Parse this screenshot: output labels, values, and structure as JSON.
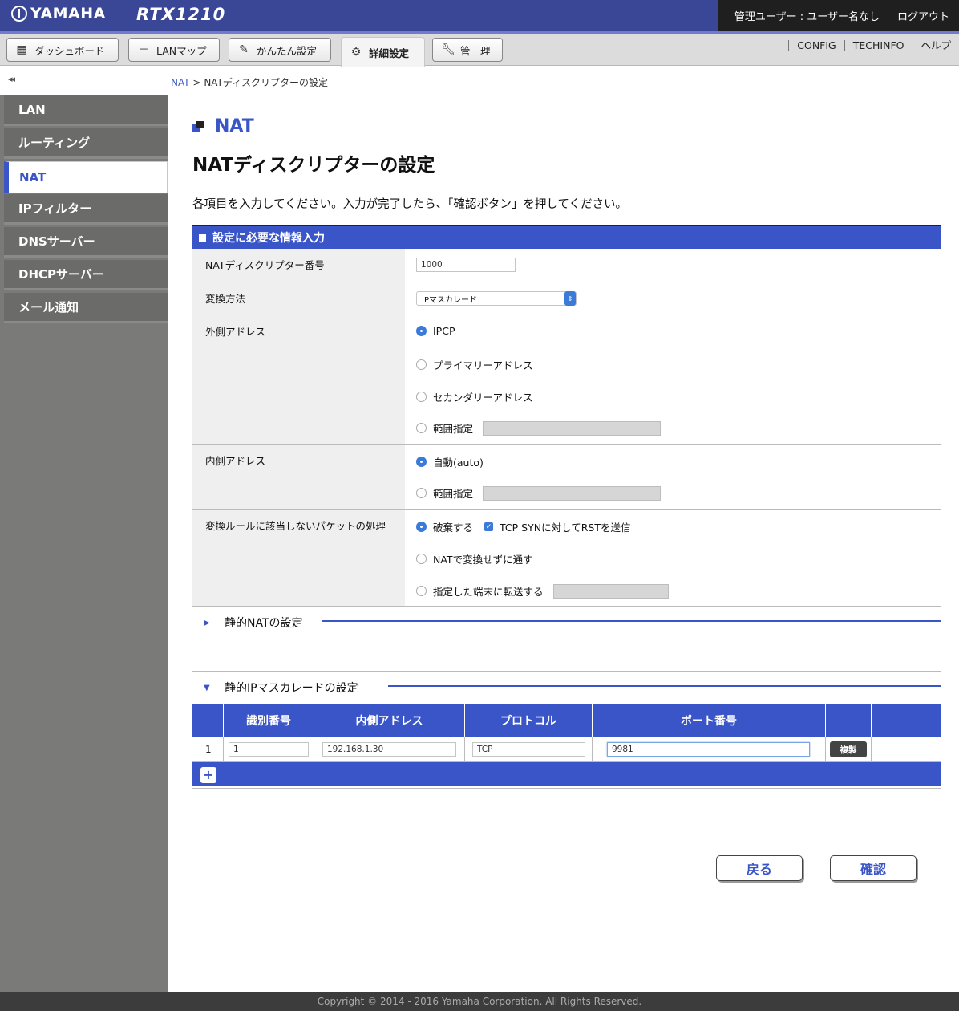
{
  "header": {
    "brand": "YAMAHA",
    "model": "RTX1210",
    "user_label": "管理ユーザー : ユーザー名なし",
    "logout": "ログアウト"
  },
  "tabs": [
    {
      "label": "ダッシュボード",
      "icon": "dashboard-icon"
    },
    {
      "label": "LANマップ",
      "icon": "lan-map-icon"
    },
    {
      "label": "かんたん設定",
      "icon": "wand-icon"
    },
    {
      "label": "詳細設定",
      "icon": "gear-icon",
      "active": true
    },
    {
      "label": "管　理",
      "icon": "wrench-icon"
    }
  ],
  "top_links": [
    "CONFIG",
    "TECHINFO",
    "ヘルプ"
  ],
  "sidebar": {
    "collapse": "◂◂",
    "items": [
      "LAN",
      "ルーティング",
      "NAT",
      "IPフィルター",
      "DNSサーバー",
      "DHCPサーバー",
      "メール通知"
    ],
    "active": "NAT"
  },
  "breadcrumb": {
    "parent": "NAT",
    "sep": ">",
    "current": "NATディスクリプターの設定"
  },
  "section_title": "NAT",
  "page_title": "NATディスクリプターの設定",
  "instruction": "各項目を入力してください。入力が完了したら、「確認ボタン」を押してください。",
  "form": {
    "heading": "設定に必要な情報入力",
    "descriptor_label": "NATディスクリプター番号",
    "descriptor_value": "1000",
    "method_label": "変換方法",
    "method_value": "IPマスカレード",
    "outer_label": "外側アドレス",
    "outer_options": [
      "IPCP",
      "プライマリーアドレス",
      "セカンダリーアドレス",
      "範囲指定"
    ],
    "outer_selected": "IPCP",
    "inner_label": "内側アドレス",
    "inner_options": [
      "自動(auto)",
      "範囲指定"
    ],
    "inner_selected": "自動(auto)",
    "nomatch_label": "変換ルールに該当しないパケットの処理",
    "nomatch_options": [
      "破棄する",
      "NATで変換せずに通す",
      "指定した端末に転送する"
    ],
    "nomatch_selected": "破棄する",
    "tcp_syn_label": "TCP SYNに対してRSTを送信",
    "tcp_syn_checked": true
  },
  "static_nat": {
    "title": "静的NATの設定",
    "expanded": false
  },
  "static_masq": {
    "title": "静的IPマスカレードの設定",
    "expanded": true,
    "columns": [
      "識別番号",
      "内側アドレス",
      "プロトコル",
      "ポート番号"
    ],
    "rows": [
      {
        "index": "1",
        "id": "1",
        "inner": "192.168.1.30",
        "protocol": "TCP",
        "port": "9981",
        "copy": "複製"
      }
    ],
    "add": "+"
  },
  "buttons": {
    "back": "戻る",
    "confirm": "確認"
  },
  "footer": "Copyright © 2014 - 2016 Yamaha Corporation. All Rights Reserved.",
  "colors": {
    "primary": "#3a55c8",
    "header": "#3a4696",
    "sidebar": "#7a7a78"
  }
}
